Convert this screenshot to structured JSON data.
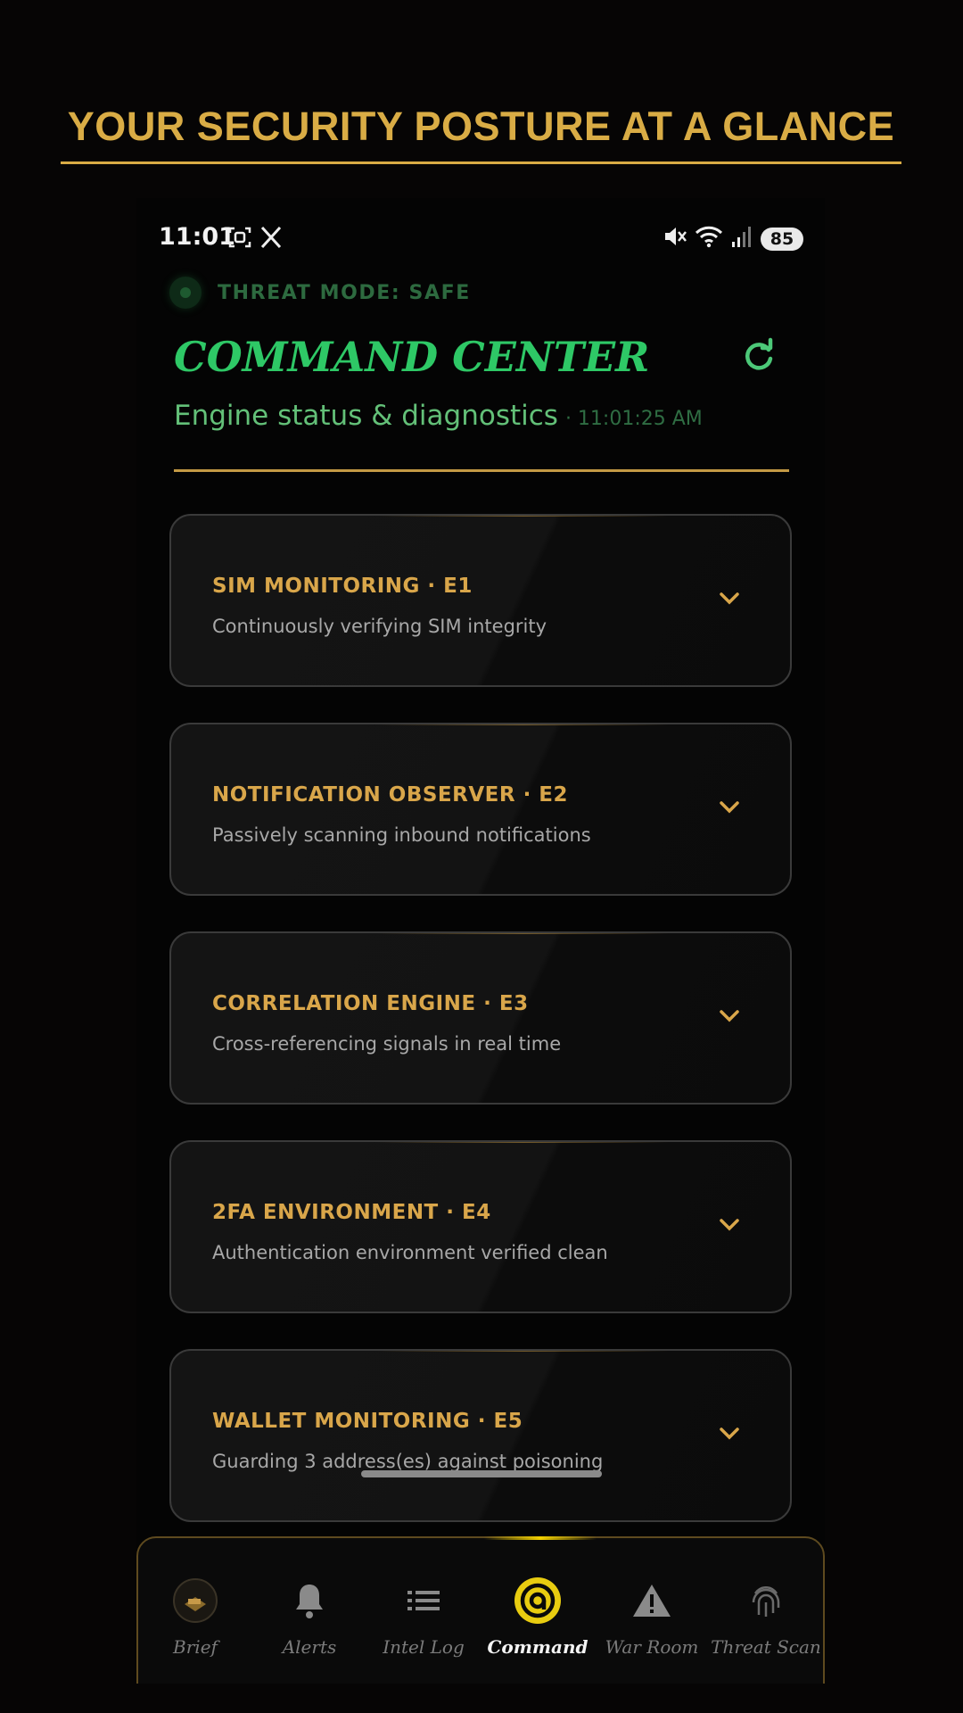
{
  "banner": {
    "title": "YOUR SECURITY POSTURE AT A GLANCE"
  },
  "status_bar": {
    "time": "11:01",
    "battery": "85",
    "left_icons": [
      "screenshot-icon",
      "x-logo-icon"
    ],
    "right_icons": [
      "mute-icon",
      "wifi-icon",
      "signal-icon"
    ]
  },
  "header": {
    "threat_mode": "THREAT MODE: SAFE",
    "title": "COMMAND CENTER",
    "subtitle": "Engine status & diagnostics",
    "timestamp": "· 11:01:25 AM"
  },
  "engines": [
    {
      "title": "SIM MONITORING · E1",
      "description": "Continuously verifying SIM integrity"
    },
    {
      "title": "NOTIFICATION OBSERVER · E2",
      "description": "Passively scanning inbound notifications"
    },
    {
      "title": "CORRELATION ENGINE · E3",
      "description": "Cross-referencing signals in real time"
    },
    {
      "title": "2FA ENVIRONMENT · E4",
      "description": "Authentication environment verified clean"
    },
    {
      "title": "WALLET MONITORING · E5",
      "description": "Guarding 3 address(es) against poisoning"
    }
  ],
  "nav": {
    "active": "Command",
    "items": [
      {
        "label": "Brief",
        "icon": "avatar-icon"
      },
      {
        "label": "Alerts",
        "icon": "bell-icon"
      },
      {
        "label": "Intel Log",
        "icon": "list-icon"
      },
      {
        "label": "Command",
        "icon": "command-target-icon"
      },
      {
        "label": "War Room",
        "icon": "warning-triangle-icon"
      },
      {
        "label": "Threat Scan",
        "icon": "fingerprint-icon"
      }
    ]
  },
  "colors": {
    "gold": "#d9ac45",
    "green": "#2ec866",
    "active_nav": "#f2d000",
    "background": "#060505"
  }
}
